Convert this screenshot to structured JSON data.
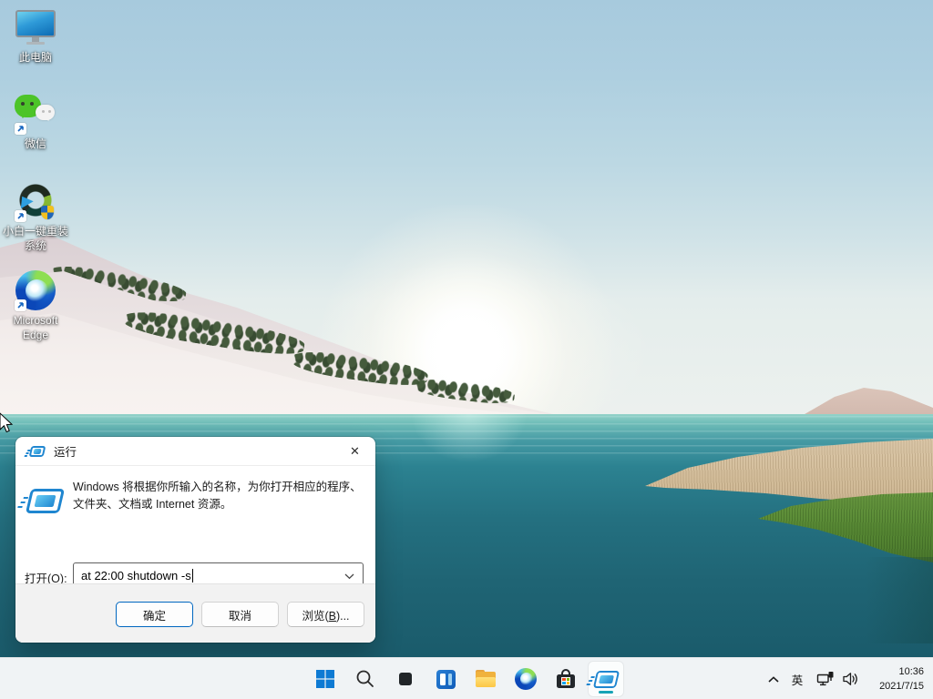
{
  "desktop": {
    "icons": [
      {
        "label": "此电脑"
      },
      {
        "label": "微信"
      },
      {
        "label": "小白一键重装",
        "label2": "系统"
      },
      {
        "label": "Microsoft",
        "label2": "Edge"
      }
    ]
  },
  "run_dialog": {
    "title": "运行",
    "close_glyph": "✕",
    "description_line1": "Windows 将根据你所输入的名称，为你打开相应的程序、",
    "description_line2": "文件夹、文档或 Internet 资源。",
    "open_label_prefix": "打开(",
    "open_label_letter": "O",
    "open_label_suffix": "):",
    "input_value": "at 22:00 shutdown -s",
    "buttons": {
      "ok": "确定",
      "cancel": "取消",
      "browse_prefix": "浏览(",
      "browse_letter": "B",
      "browse_suffix": ")..."
    }
  },
  "taskbar": {
    "icons": [
      "start",
      "search",
      "task-view",
      "widgets",
      "file-explorer",
      "edge",
      "microsoft-store",
      "run-active"
    ],
    "tray": {
      "hidden_icons": "chevron-up",
      "language_indicator": "英",
      "network_icon": "ethernet",
      "volume_icon": "speaker",
      "time": "10:36",
      "date": "2021/7/15"
    }
  },
  "colors": {
    "accent": "#0067c0",
    "run_icon_blue": "#1f86d0",
    "taskbar_bg": "#f0f3f5",
    "active_app_indicator": "#16a3b6",
    "water_deep": "#1f6474",
    "sky_top": "#a7cadd"
  }
}
